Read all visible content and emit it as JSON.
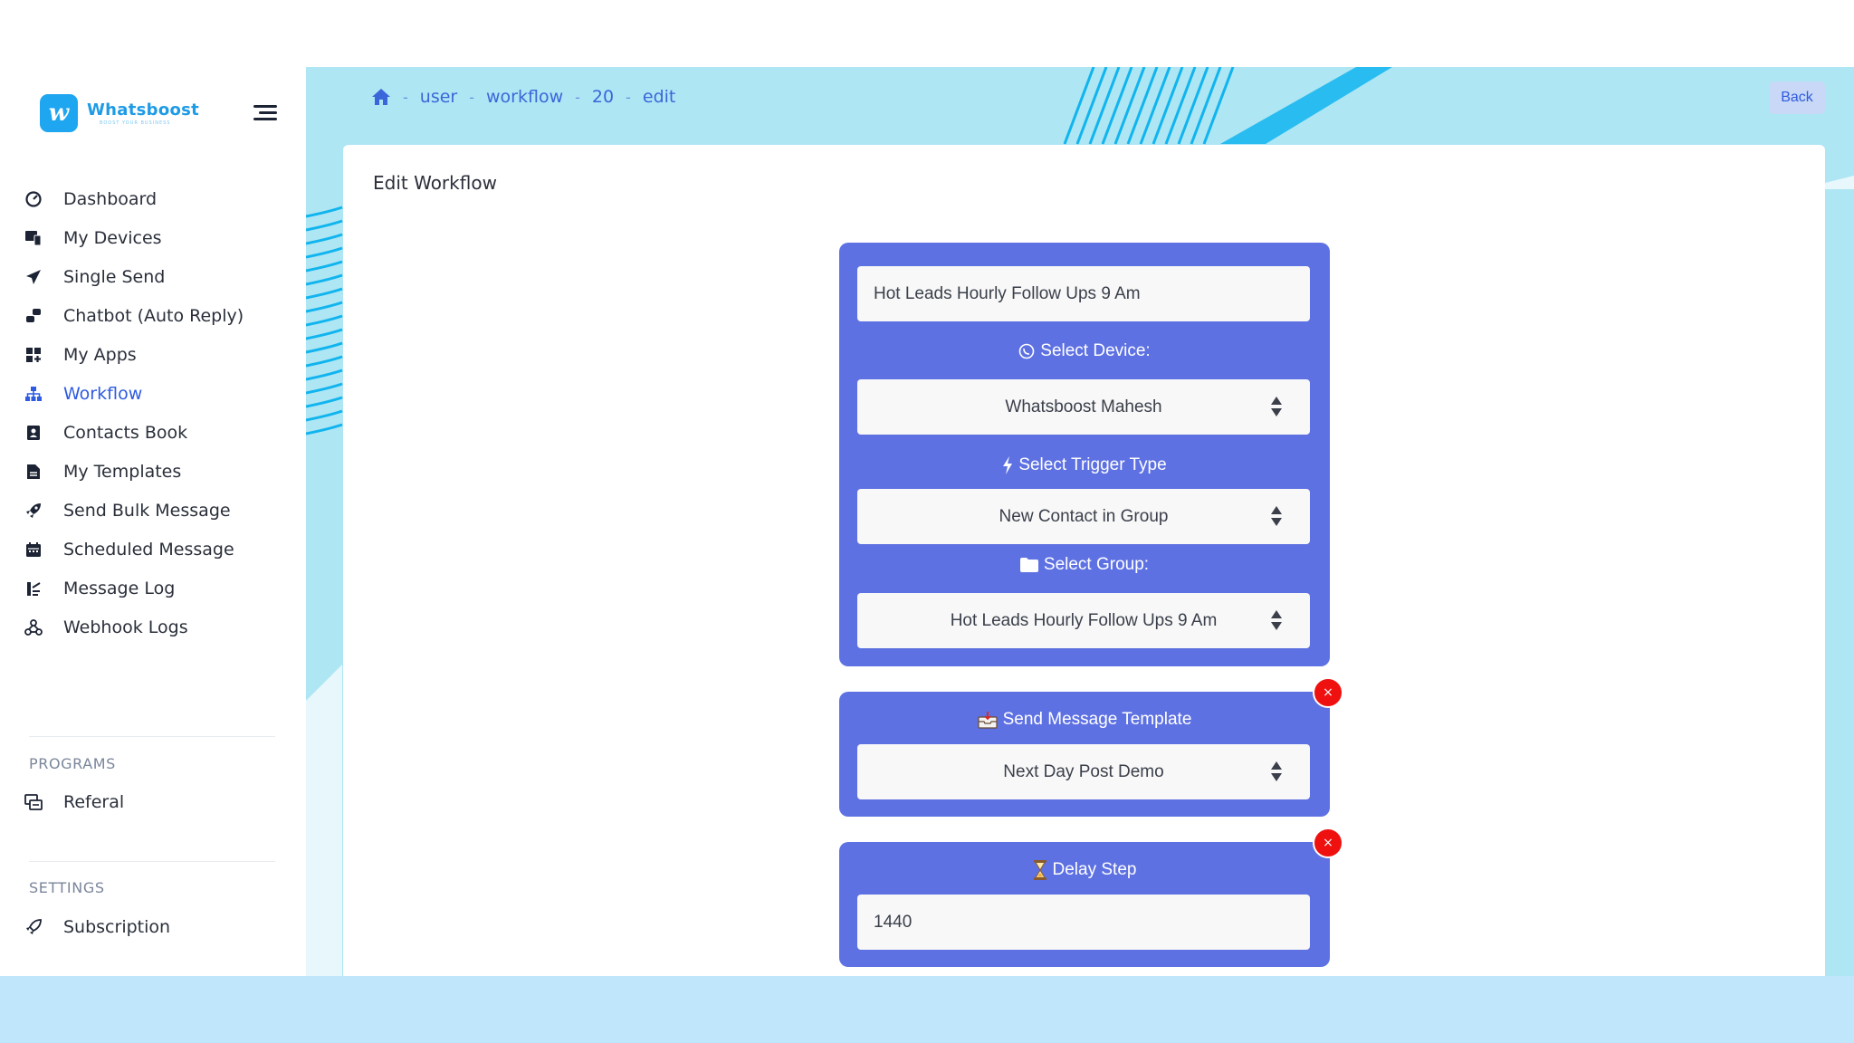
{
  "app": {
    "name": "Whatsboost",
    "tagline": "BOOST YOUR BUSINESS",
    "logo_letter": "w"
  },
  "colors": {
    "primary": "#2f5be0",
    "brand": "#1e9be6",
    "workflow_block": "#5e71e2",
    "danger": "#ef1010",
    "main_bg": "#aee6f4"
  },
  "sidebar": {
    "items": [
      {
        "label": "Dashboard",
        "icon": "gauge-icon"
      },
      {
        "label": "My Devices",
        "icon": "devices-icon"
      },
      {
        "label": "Single Send",
        "icon": "paper-plane-icon"
      },
      {
        "label": "Chatbot (Auto Reply)",
        "icon": "robot-icon"
      },
      {
        "label": "My Apps",
        "icon": "apps-grid-icon"
      },
      {
        "label": "Workflow",
        "icon": "sitemap-icon",
        "active": true
      },
      {
        "label": "Contacts Book",
        "icon": "address-book-icon"
      },
      {
        "label": "My Templates",
        "icon": "file-icon"
      },
      {
        "label": "Send Bulk Message",
        "icon": "rocket-icon"
      },
      {
        "label": "Scheduled Message",
        "icon": "calendar-icon"
      },
      {
        "label": "Message Log",
        "icon": "log-icon"
      },
      {
        "label": "Webhook Logs",
        "icon": "webhook-icon"
      }
    ],
    "programs_title": "PROGRAMS",
    "programs": [
      {
        "label": "Referal",
        "icon": "referral-icon"
      }
    ],
    "settings_title": "SETTINGS",
    "settings": [
      {
        "label": "Subscription",
        "icon": "subscription-icon"
      }
    ]
  },
  "breadcrumb": {
    "home_icon": "home-icon",
    "items": [
      "user",
      "workflow",
      "20",
      "edit"
    ],
    "separator": "-"
  },
  "header": {
    "back_label": "Back"
  },
  "card": {
    "title": "Edit Workflow"
  },
  "workflow": {
    "name_value": "Hot Leads Hourly Follow Ups 9 Am",
    "device_label": "Select Device:",
    "device_value": "Whatsboost Mahesh",
    "trigger_label": "Select Trigger Type",
    "trigger_value": "New Contact in Group",
    "group_label": "Select Group:",
    "group_value": "Hot Leads Hourly Follow Ups 9 Am",
    "template_step_label": "Send Message Template",
    "template_value": "Next Day Post Demo",
    "delay_step_label": "Delay Step",
    "delay_value": "1440",
    "remove_label": "×"
  }
}
